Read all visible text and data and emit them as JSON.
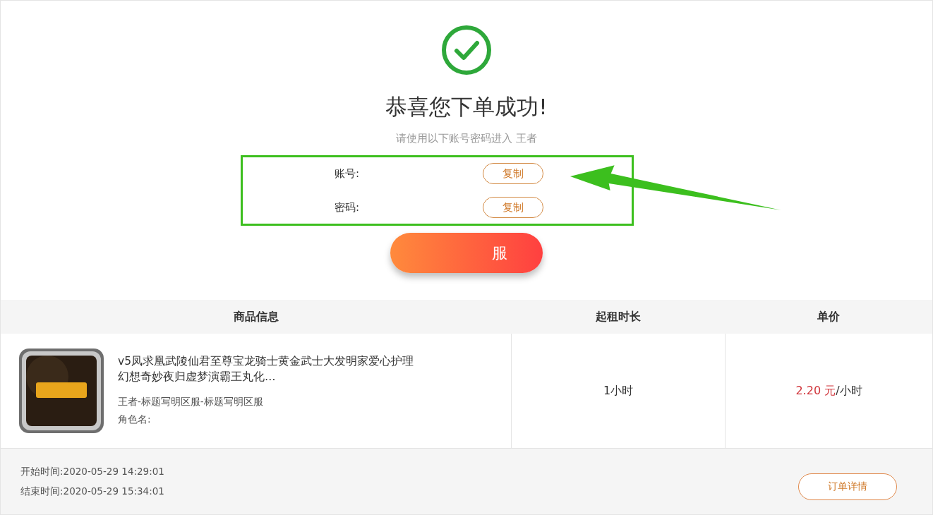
{
  "success": {
    "title": "恭喜您下单成功!",
    "subtitle": "请使用以下账号密码进入 王者"
  },
  "credentials": [
    {
      "label": "账号:",
      "copy": "复制"
    },
    {
      "label": "密码:",
      "copy": "复制"
    }
  ],
  "service_button": "服",
  "table": {
    "columns": [
      "商品信息",
      "起租时长",
      "单价"
    ],
    "rows": [
      {
        "title": "v5凤求凰武陵仙君至尊宝龙骑士黄金武士大发明家爱心护理幻想奇妙夜归虚梦演霸王丸化…",
        "server": "王者-标题写明区服-标题写明区服",
        "role_label": "角色名:",
        "duration": "1小时",
        "price": "2.20 元",
        "price_unit": "/小时"
      }
    ]
  },
  "footer": {
    "start": "开始时间:2020-05-29 14:29:01",
    "end": "结束时间:2020-05-29 15:34:01",
    "details_button": "订单详情"
  }
}
